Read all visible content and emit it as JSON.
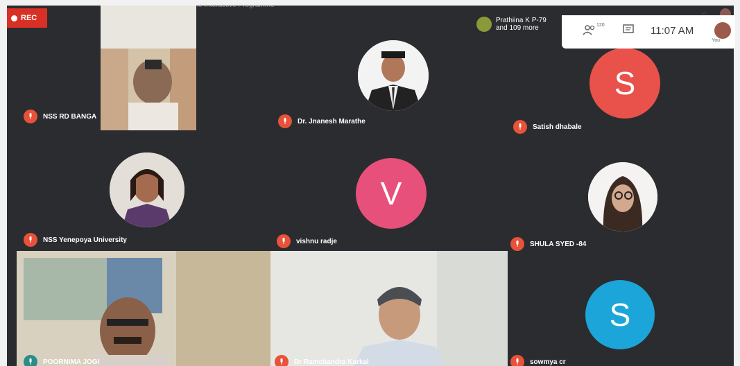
{
  "window": {
    "title": "State Level Online Interactive Programme"
  },
  "recording": {
    "label": "REC"
  },
  "participants": {
    "summary_line1": "Prathiina K P-79",
    "summary_line2": "and 109 more",
    "count": "120"
  },
  "clock": {
    "time": "11:07 AM"
  },
  "self": {
    "label": "You"
  },
  "tiles": [
    {
      "name": "NSS RD BANGA"
    },
    {
      "name": "Dr. Jnanesh Marathe"
    },
    {
      "name": "Satish dhabale",
      "initial": "S",
      "color": "#e8524a"
    },
    {
      "name": "NSS Yenepoya University"
    },
    {
      "name": "vishnu radje",
      "initial": "V",
      "color": "#e6507b"
    },
    {
      "name": "SHULA SYED -84"
    },
    {
      "name": "POORNIMA JOGI"
    },
    {
      "name": "Dr Ramchandra Karkal"
    },
    {
      "name": "sowmya cr",
      "initial": "S",
      "color": "#1ca5d8"
    }
  ]
}
